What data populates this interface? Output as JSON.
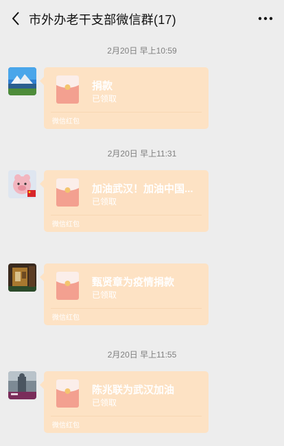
{
  "header": {
    "title": "市外办老干支部微信群(17)"
  },
  "messages": [
    {
      "time": "2月20日 早上10:59",
      "packet": {
        "message": "捐款",
        "status": "已领取",
        "brand": "微信红包"
      }
    },
    {
      "time": "2月20日 早上11:31",
      "packet": {
        "message": "加油武汉！加油中国...",
        "status": "已领取",
        "brand": "微信红包"
      }
    },
    {
      "time": "",
      "packet": {
        "message": "甄贤章为疫情捐款",
        "status": "已领取",
        "brand": "微信红包"
      }
    },
    {
      "time": "2月20日 早上11:55",
      "packet": {
        "message": "陈兆联为武汉加油",
        "status": "已领取",
        "brand": "微信红包"
      }
    }
  ],
  "colors": {
    "background": "#ededed",
    "packet_bubble": "#fde2c4",
    "envelope": "#f3a090",
    "envelope_flap": "#fbeeea",
    "envelope_seal": "#f4c56f"
  }
}
